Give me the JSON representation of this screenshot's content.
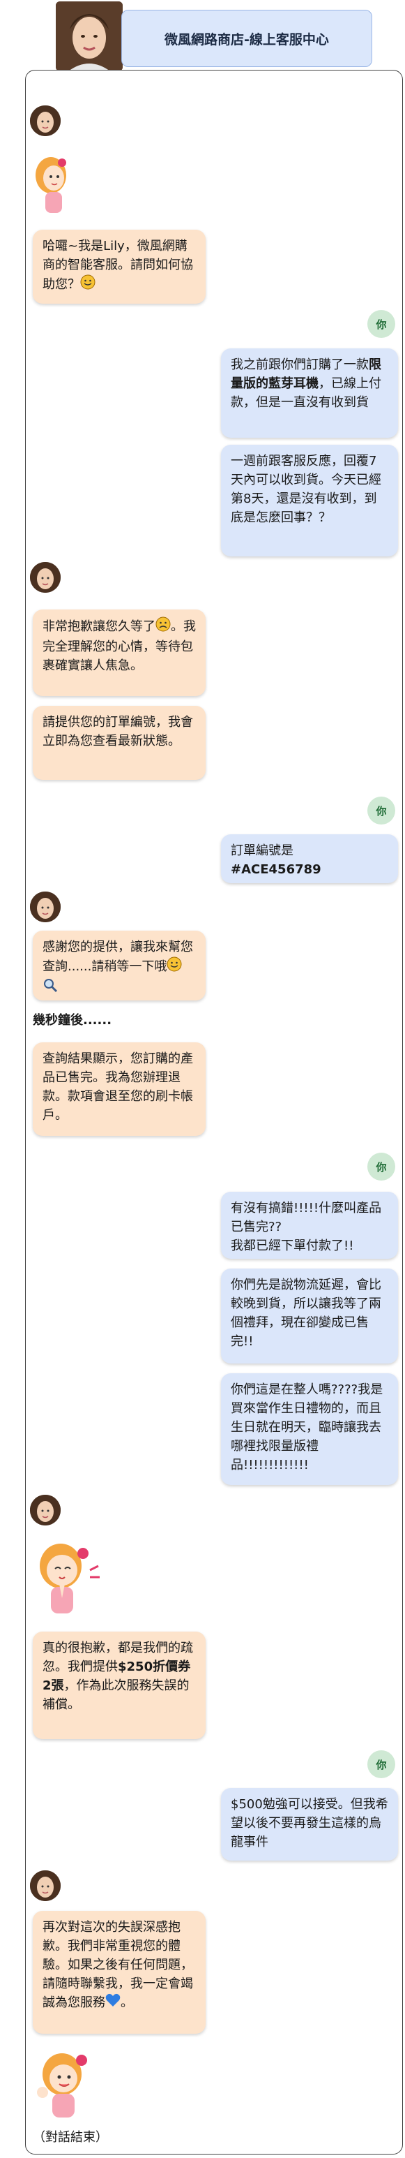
{
  "header": {
    "title": "微風網路商店-線上客服中心"
  },
  "user_label": "你",
  "messages": [
    {
      "id": "m1",
      "from": "bot",
      "text_a": "哈囉~我是Lily，微風網購商的智能客服。請問如何協助您？"
    },
    {
      "id": "m2",
      "from": "user",
      "pre": "我之前跟你們訂購了一款",
      "bold": "限量版的藍芽耳機",
      "post": "，已線上付款，但是一直沒有收到貨"
    },
    {
      "id": "m3",
      "from": "user",
      "text": "一週前跟客服反應，回覆7天內可以收到貨。今天已經第8天，還是沒有收到，到底是怎麼回事？？"
    },
    {
      "id": "m4",
      "from": "bot",
      "pre": "非常抱歉讓您久等了",
      "post": "。我完全理解您的心情，等待包裹確實讓人焦急。"
    },
    {
      "id": "m5",
      "from": "bot",
      "text": "請提供您的訂單編號，我會立即為您查看最新狀態。"
    },
    {
      "id": "m6",
      "from": "user",
      "line1": "訂單編號是",
      "line2": "#ACE456789"
    },
    {
      "id": "m7",
      "from": "bot",
      "text": "感謝您的提供，讓我來幫您查詢......請稍等一下哦"
    },
    {
      "id": "m8",
      "from": "bot",
      "text": "查詢結果顯示，您訂購的產品已售完。我為您辦理退款。款項會退至您的刷卡帳戶。"
    },
    {
      "id": "m9",
      "from": "user",
      "text": "有沒有搞錯!!!!!什麼叫產品已售完??\n我都已經下單付款了!!"
    },
    {
      "id": "m10",
      "from": "user",
      "text": "你們先是說物流延遲，會比較晚到貨，所以讓我等了兩個禮拜，現在卻變成已售完!!"
    },
    {
      "id": "m11",
      "from": "user",
      "text": "你們這是在整人嗎????我是買來當作生日禮物的，而且生日就在明天，臨時讓我去哪裡找限量版禮品!!!!!!!!!!!!!"
    },
    {
      "id": "m12",
      "from": "bot",
      "pre": "真的很抱歉，都是我們的疏忽。我們提供",
      "bold": "$250折價券2張",
      "post": "，作為此次服務失誤的補償。"
    },
    {
      "id": "m13",
      "from": "user",
      "text": "$500勉強可以接受。但我希望以後不要再發生這樣的烏龍事件"
    },
    {
      "id": "m14",
      "from": "bot",
      "text": "再次對這次的失誤深感抱歉。我們非常重視您的體驗。如果之後有任何問題，請隨時聯繫我，我一定會竭誠為您服務"
    }
  ],
  "notes": {
    "few_seconds_later": "幾秒鐘後......"
  },
  "end_text": "（對話結束）"
}
